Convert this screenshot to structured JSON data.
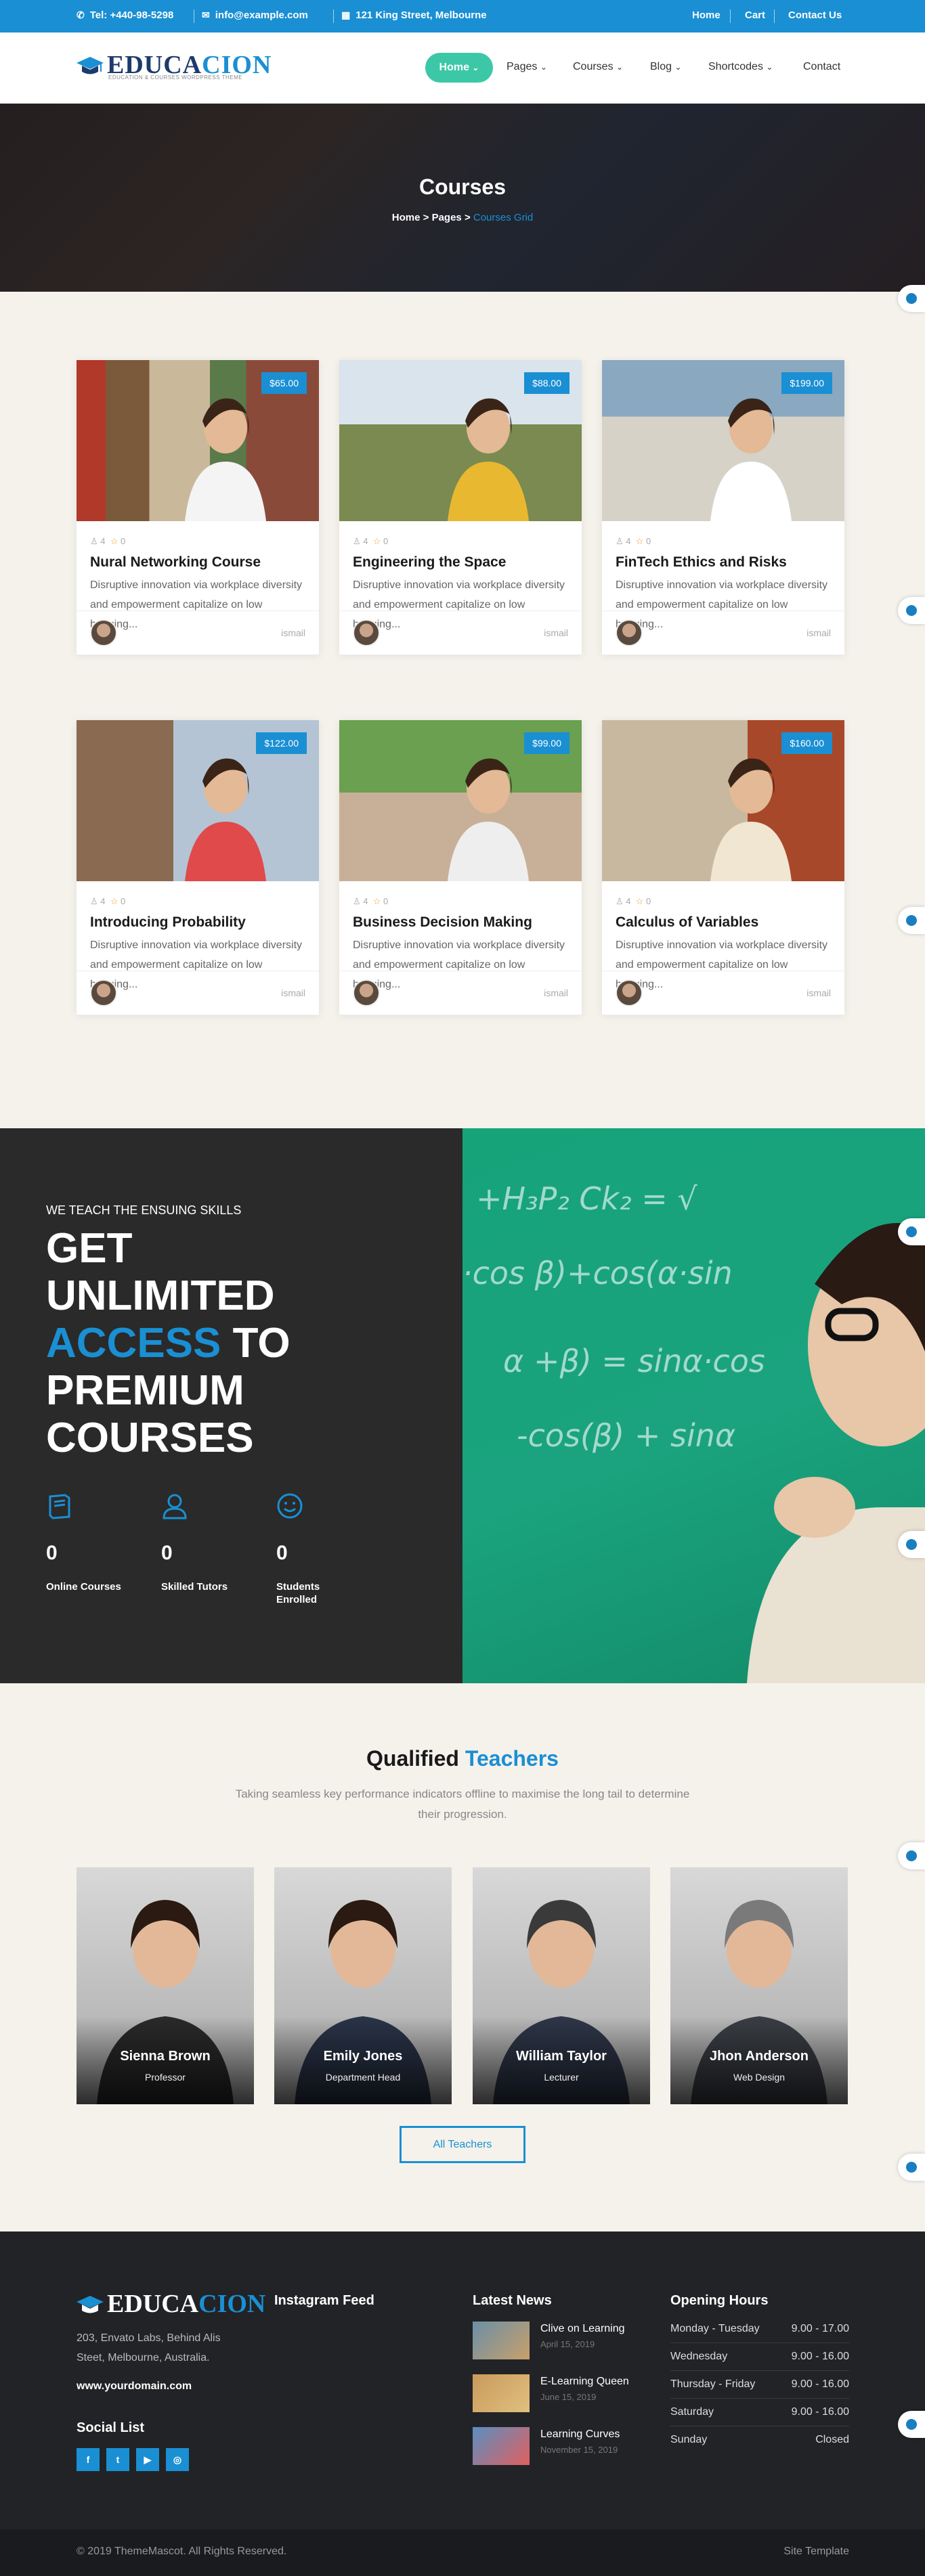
{
  "topbar": {
    "phone": "Tel: +440-98-5298",
    "email": "info@example.com",
    "address": "121 King Street, Melbourne",
    "links": [
      "Home",
      "Cart",
      "Contact Us"
    ]
  },
  "header": {
    "logo_main": "EDUCA",
    "logo_accent": "CION",
    "logo_tagline": "EDUCATION & COURSES WORDPRESS THEME",
    "nav": [
      {
        "label": "Home",
        "caret": "⌄"
      },
      {
        "label": "Pages",
        "caret": "⌄"
      },
      {
        "label": "Courses",
        "caret": "⌄"
      },
      {
        "label": "Blog",
        "caret": "⌄"
      },
      {
        "label": "Shortcodes",
        "caret": "⌄"
      },
      {
        "label": "Contact",
        "caret": ""
      }
    ]
  },
  "hero": {
    "title": "Courses",
    "crumb_home": "Home",
    "crumb_pages": "Pages",
    "crumb_current": "Courses Grid",
    "crumb_sep": ">"
  },
  "courses": [
    {
      "price": "$65.00",
      "users": "4",
      "rating": "0",
      "title": "Nural Networking Course",
      "desc": "Disruptive innovation via workplace diversity and empowerment capitalize on low hanging...",
      "author": "ismail"
    },
    {
      "price": "$88.00",
      "users": "4",
      "rating": "0",
      "title": "Engineering the Space",
      "desc": "Disruptive innovation via workplace diversity and empowerment capitalize on low hanging...",
      "author": "ismail"
    },
    {
      "price": "$199.00",
      "users": "4",
      "rating": "0",
      "title": "FinTech Ethics and Risks",
      "desc": "Disruptive innovation via workplace diversity and empowerment capitalize on low hanging...",
      "author": "ismail"
    },
    {
      "price": "$122.00",
      "users": "4",
      "rating": "0",
      "title": "Introducing Probability",
      "desc": "Disruptive innovation via workplace diversity and empowerment capitalize on low hanging...",
      "author": "ismail"
    },
    {
      "price": "$99.00",
      "users": "4",
      "rating": "0",
      "title": "Business Decision Making",
      "desc": "Disruptive innovation via workplace diversity and empowerment capitalize on low hanging...",
      "author": "ismail"
    },
    {
      "price": "$160.00",
      "users": "4",
      "rating": "0",
      "title": "Calculus of Variables",
      "desc": "Disruptive innovation via workplace diversity and empowerment capitalize on low hanging...",
      "author": "ismail"
    }
  ],
  "skills": {
    "subtitle": "WE TEACH THE ENSUING SKILLS",
    "h1": "GET",
    "h2": "UNLIMITED",
    "h3_blue": "ACCESS",
    "h3_rest": " TO",
    "h4": "PREMIUM",
    "h5": "COURSES",
    "stats": [
      {
        "num": "0",
        "label": "Online Courses",
        "icon": "book-icon"
      },
      {
        "num": "0",
        "label": "Skilled Tutors",
        "icon": "user-icon"
      },
      {
        "num": "0",
        "label": "Students Enrolled",
        "icon": "smiley-icon"
      }
    ]
  },
  "teachers": {
    "title_a": "Qualified",
    "title_b": "Teachers",
    "desc": "Taking seamless key performance indicators offline to maximise the long tail to determine their progression.",
    "list": [
      {
        "name": "Sienna Brown",
        "role": "Professor"
      },
      {
        "name": "Emily Jones",
        "role": "Department Head"
      },
      {
        "name": "William Taylor",
        "role": "Lecturer"
      },
      {
        "name": "Jhon Anderson",
        "role": "Web Design"
      }
    ],
    "button": "All Teachers"
  },
  "footer": {
    "logo_main": "EDUCA",
    "logo_accent": "CION",
    "address": "203, Envato Labs, Behind Alis Steet, Melbourne, Australia.",
    "website": "www.yourdomain.com",
    "social_title": "Social List",
    "social": [
      {
        "icon": "facebook-icon",
        "glyph": "f"
      },
      {
        "icon": "twitter-icon",
        "glyph": "t"
      },
      {
        "icon": "youtube-icon",
        "glyph": "▶"
      },
      {
        "icon": "instagram-icon",
        "glyph": "◎"
      }
    ],
    "instagram_title": "Instagram Feed",
    "news_title": "Latest News",
    "news": [
      {
        "title": "Clive on Learning",
        "date": "April 15, 2019"
      },
      {
        "title": "E-Learning Queen",
        "date": "June 15, 2019"
      },
      {
        "title": "Learning Curves",
        "date": "November 15, 2019"
      }
    ],
    "hours_title": "Opening Hours",
    "hours": [
      {
        "day": "Monday - Tuesday",
        "time": "9.00 - 17.00"
      },
      {
        "day": "Wednesday",
        "time": "9.00 - 16.00"
      },
      {
        "day": "Thursday - Friday",
        "time": "9.00 - 16.00"
      },
      {
        "day": "Saturday",
        "time": "9.00 - 16.00"
      },
      {
        "day": "Sunday",
        "time": "Closed"
      }
    ],
    "copyright": "© 2019 ThemeMascot. All Rights Reserved.",
    "site_template": "Site Template"
  },
  "colors": {
    "accent": "#1a8fd3",
    "nav_active": "#3cc8a7",
    "dark": "#2a2a2a"
  }
}
